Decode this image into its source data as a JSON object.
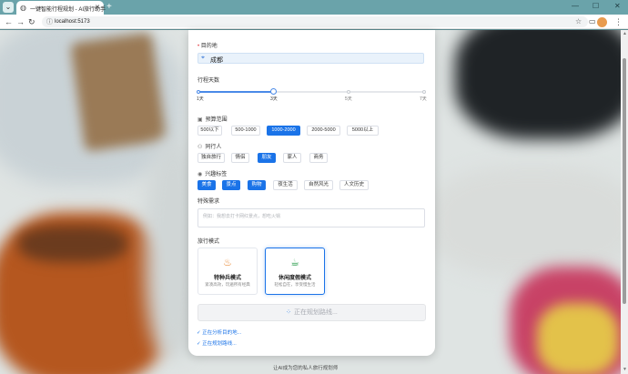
{
  "browser": {
    "tab_title": "一键智能行程规划 - AI旅行助手",
    "new_tab": "+",
    "url": "localhost:5173",
    "minimize": "—",
    "maximize": "☐",
    "close": "✕"
  },
  "form": {
    "destination": {
      "label": "目的地",
      "value": "成都"
    },
    "days": {
      "label": "行程天数",
      "ticks": [
        "1天",
        "3天",
        "5天",
        "7天"
      ],
      "selected": "3天"
    },
    "budget": {
      "label": "预算范围",
      "options": [
        "500以下",
        "500-1000",
        "1000-2000",
        "2000-5000",
        "5000以上"
      ],
      "selected": "1000-2000"
    },
    "companions": {
      "label": "同行人",
      "options": [
        "独自旅行",
        "情侣",
        "朋友",
        "家人",
        "商务"
      ],
      "selected": "朋友"
    },
    "interests": {
      "label": "兴趣标签",
      "options": [
        "美食",
        "景点",
        "购物",
        "夜生活",
        "自然风光",
        "人文历史"
      ],
      "selected": [
        "美食",
        "景点",
        "购物"
      ]
    },
    "special": {
      "label": "特殊需求",
      "placeholder": "例如：我想去打卡网红景点，想吃火锅"
    },
    "travel_mode": {
      "label": "旅行模式",
      "modes": [
        {
          "title": "特种兵模式",
          "desc": "紧凑高效，玩遍所有经典",
          "icon": "rocket-icon"
        },
        {
          "title": "休闲度假模式",
          "desc": "轻松自在，享受慢生活",
          "icon": "coffee-icon"
        }
      ],
      "selected": "休闲度假模式"
    },
    "submit_label": "正在规划路线...",
    "status_lines": [
      "✓ 正在分析目的地...",
      "✓ 正在规划路线..."
    ]
  },
  "footer": "让AI成为您的私人旅行规划师",
  "colors": {
    "accent": "#1a73e8",
    "tabbar": "#6aa3aa"
  }
}
